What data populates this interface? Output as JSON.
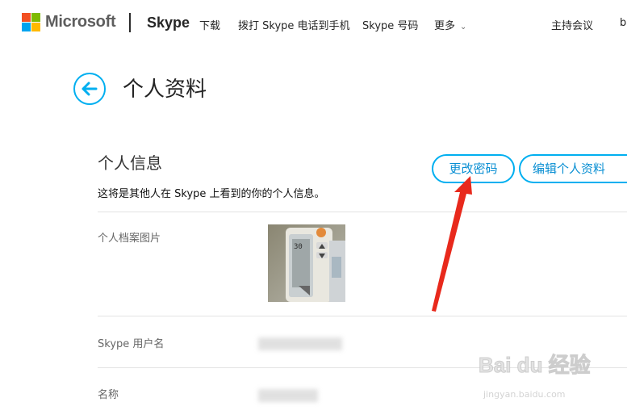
{
  "header": {
    "ms_logo_text": "Microsoft",
    "ms_logo_colors": [
      "#f25022",
      "#7fba00",
      "#00a4ef",
      "#ffb900"
    ],
    "brand": "Skype",
    "nav": [
      {
        "label": "下载"
      },
      {
        "label": "拨打 Skype 电话到手机"
      },
      {
        "label": "Skype 号码"
      },
      {
        "label": "更多",
        "has_chevron": true
      },
      {
        "label": "主持会议"
      },
      {
        "label": "b"
      }
    ]
  },
  "page": {
    "title": "个人资料",
    "back_icon": "arrow-left-icon"
  },
  "section": {
    "title": "个人信息",
    "description": "这将是其他人在 Skype 上看到的你的个人信息。",
    "change_password_label": "更改密码",
    "edit_profile_label": "编辑个人资料"
  },
  "rows": {
    "avatar_label": "个人档案图片",
    "username_label": "Skype 用户名",
    "name_label": "名称"
  },
  "colors": {
    "accent": "#00aff0",
    "annotation": "#e8291c"
  },
  "watermark": {
    "brand": "Bai du 经验",
    "url": "jingyan.baidu.com"
  }
}
